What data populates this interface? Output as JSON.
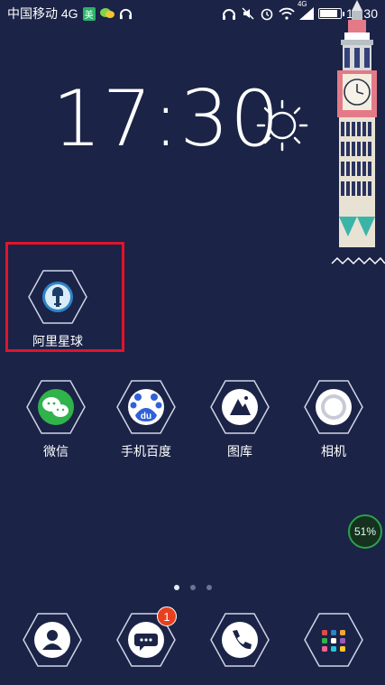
{
  "status_bar": {
    "carrier": "中国移动 4G",
    "carrier_badge": "美",
    "time": "17:30",
    "network_label": "4G",
    "battery_level": 0.9,
    "icons": [
      "wechat-notif-icon",
      "headset-icon",
      "headphone-icon",
      "mute-icon",
      "alarm-icon",
      "wifi-icon",
      "signal-icon",
      "battery-icon"
    ]
  },
  "widget": {
    "time": "17:30",
    "weather_icon": "sun-icon"
  },
  "highlighted_app": {
    "label": "阿里星球",
    "icon": "ali-planet-icon"
  },
  "apps": [
    {
      "label": "微信",
      "icon": "wechat-icon"
    },
    {
      "label": "手机百度",
      "icon": "baidu-icon"
    },
    {
      "label": "图库",
      "icon": "gallery-icon"
    },
    {
      "label": "相机",
      "icon": "camera-icon"
    }
  ],
  "memory_badge": "51%",
  "memory_level": 0.51,
  "page_dots": {
    "count": 3,
    "active": 0
  },
  "dock": [
    {
      "icon": "contacts-icon"
    },
    {
      "icon": "messages-icon",
      "badge": "1"
    },
    {
      "icon": "phone-icon"
    },
    {
      "icon": "app-drawer-icon"
    }
  ],
  "colors": {
    "background": "#1b2347",
    "highlight": "#e0142b",
    "notif_badge": "#e8401f",
    "tower_accent": "#e47a88"
  }
}
